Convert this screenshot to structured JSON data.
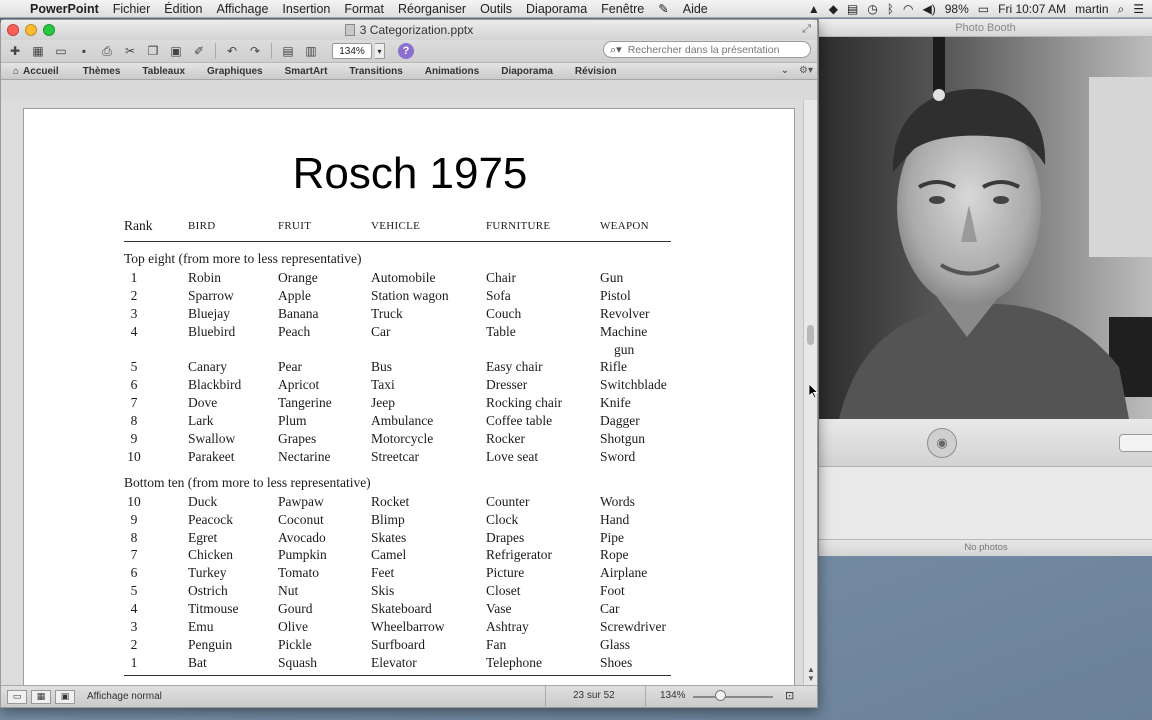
{
  "menubar": {
    "app_name": "PowerPoint",
    "items": [
      "Fichier",
      "Édition",
      "Affichage",
      "Insertion",
      "Format",
      "Réorganiser",
      "Outils",
      "Diaporama",
      "Fenêtre",
      "Aide"
    ],
    "battery": "98%",
    "clock": "Fri 10:07 AM",
    "user": "martin"
  },
  "ppt": {
    "window_title": "3 Categorization.pptx",
    "zoom": "134%",
    "search_placeholder": "Rechercher dans la présentation",
    "ribbon_tabs": [
      "Accueil",
      "Thèmes",
      "Tableaux",
      "Graphiques",
      "SmartArt",
      "Transitions",
      "Animations",
      "Diaporama",
      "Révision"
    ],
    "status": {
      "view_mode": "Affichage normal",
      "page": "23 sur 52",
      "zoom": "134%"
    }
  },
  "slide": {
    "title": "Rosch 1975",
    "headers": [
      "Rank",
      "BIRD",
      "FRUIT",
      "VEHICLE",
      "FURNITURE",
      "WEAPON"
    ],
    "top_section_label": "Top eight (from more to less representative)",
    "bottom_section_label": "Bottom ten (from more to less representative)",
    "top_rows": [
      [
        "1",
        "Robin",
        "Orange",
        "Automobile",
        "Chair",
        "Gun"
      ],
      [
        "2",
        "Sparrow",
        "Apple",
        "Station wagon",
        "Sofa",
        "Pistol"
      ],
      [
        "3",
        "Bluejay",
        "Banana",
        "Truck",
        "Couch",
        "Revolver"
      ],
      [
        "4",
        "Bluebird",
        "Peach",
        "Car",
        "Table",
        "Machine"
      ],
      [
        "5",
        "Canary",
        "Pear",
        "Bus",
        "Easy chair",
        "Rifle"
      ],
      [
        "6",
        "Blackbird",
        "Apricot",
        "Taxi",
        "Dresser",
        "Switchblade"
      ],
      [
        "7",
        "Dove",
        "Tangerine",
        "Jeep",
        "Rocking chair",
        "Knife"
      ],
      [
        "8",
        "Lark",
        "Plum",
        "Ambulance",
        "Coffee table",
        "Dagger"
      ],
      [
        "9",
        "Swallow",
        "Grapes",
        "Motorcycle",
        "Rocker",
        "Shotgun"
      ],
      [
        "10",
        "Parakeet",
        "Nectarine",
        "Streetcar",
        "Love seat",
        "Sword"
      ]
    ],
    "machine_gun_cont": "gun",
    "bottom_rows": [
      [
        "10",
        "Duck",
        "Pawpaw",
        "Rocket",
        "Counter",
        "Words"
      ],
      [
        "9",
        "Peacock",
        "Coconut",
        "Blimp",
        "Clock",
        "Hand"
      ],
      [
        "8",
        "Egret",
        "Avocado",
        "Skates",
        "Drapes",
        "Pipe"
      ],
      [
        "7",
        "Chicken",
        "Pumpkin",
        "Camel",
        "Refrigerator",
        "Rope"
      ],
      [
        "6",
        "Turkey",
        "Tomato",
        "Feet",
        "Picture",
        "Airplane"
      ],
      [
        "5",
        "Ostrich",
        "Nut",
        "Skis",
        "Closet",
        "Foot"
      ],
      [
        "4",
        "Titmouse",
        "Gourd",
        "Skateboard",
        "Vase",
        "Car"
      ],
      [
        "3",
        "Emu",
        "Olive",
        "Wheelbarrow",
        "Ashtray",
        "Screwdriver"
      ],
      [
        "2",
        "Penguin",
        "Pickle",
        "Surfboard",
        "Fan",
        "Glass"
      ],
      [
        "1",
        "Bat",
        "Squash",
        "Elevator",
        "Telephone",
        "Shoes"
      ]
    ]
  },
  "photobooth": {
    "window_title": "Photo Booth",
    "footer": "No photos"
  }
}
